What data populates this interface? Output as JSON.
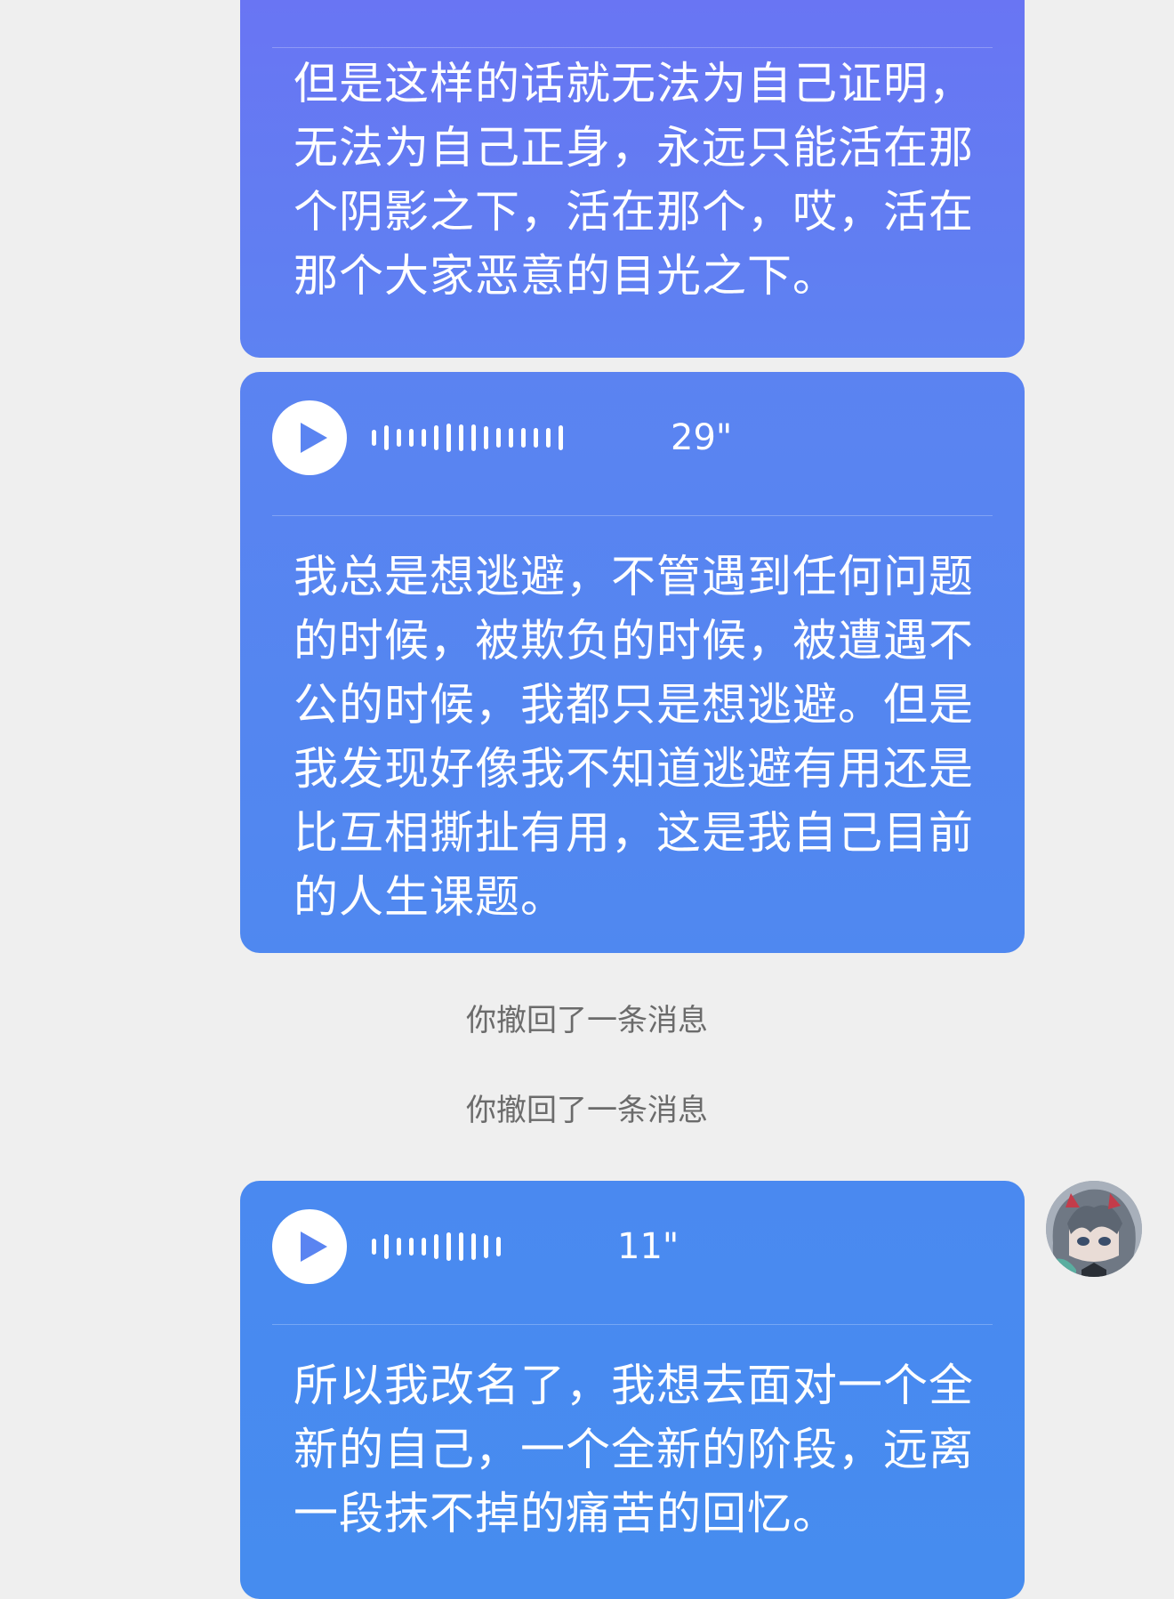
{
  "messages": [
    {
      "id": "msg1",
      "text": "但是这样的话就无法为自己证明，无法为自己正身，永远只能活在那个阴影之下，活在那个，哎，活在那个大家恶意的目光之下。"
    },
    {
      "id": "msg2",
      "voice_duration": "29\"",
      "text": "我总是想逃避，不管遇到任何问题的时候，被欺负的时候，被遭遇不公的时候，我都只是想逃避。但是我发现好像我不知道逃避有用还是比互相撕扯有用，这是我自己目前的人生课题。"
    },
    {
      "id": "msg3",
      "voice_duration": "11\"",
      "text": "所以我改名了，我想去面对一个全新的自己，一个全新的阶段，远离一段抹不掉的痛苦的回忆。"
    }
  ],
  "system_messages": [
    "你撤回了一条消息",
    "你撤回了一条消息"
  ],
  "colors": {
    "background": "#efefef",
    "bubble_top": "#6a74f3",
    "bubble_bottom": "#468cef",
    "text": "#ffffff",
    "system_text": "#6b6b6b"
  },
  "icons": {
    "play": "play-icon",
    "waveform": "waveform-icon",
    "avatar": "avatar-image"
  }
}
